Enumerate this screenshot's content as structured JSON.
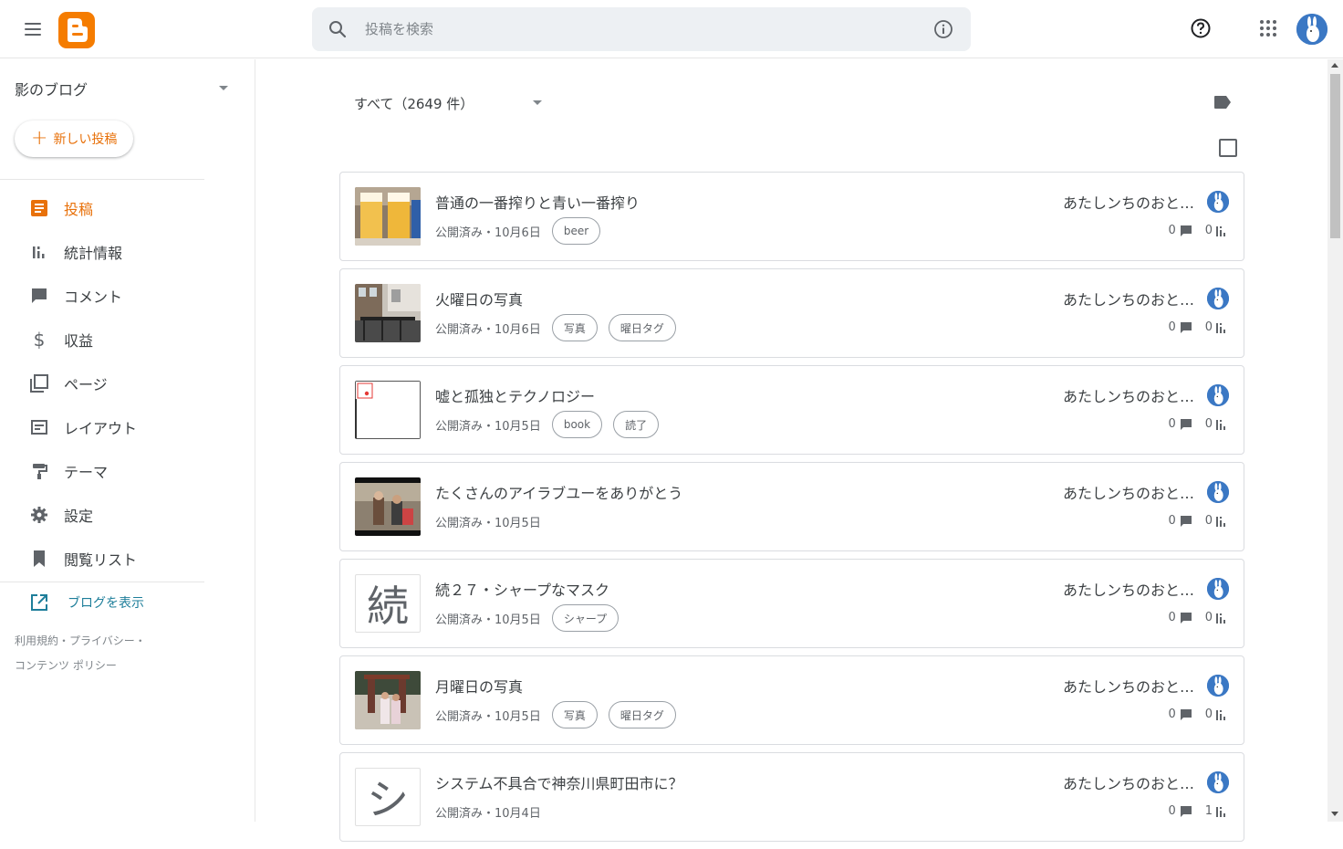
{
  "search": {
    "placeholder": "投稿を検索"
  },
  "sidebar": {
    "blog_name": "影のブログ",
    "new_post_label": "新しい投稿",
    "items": [
      {
        "label": "投稿",
        "icon": "posts-icon",
        "active": true
      },
      {
        "label": "統計情報",
        "icon": "stats-icon",
        "active": false
      },
      {
        "label": "コメント",
        "icon": "comment-icon",
        "active": false
      },
      {
        "label": "収益",
        "icon": "dollar-icon",
        "active": false
      },
      {
        "label": "ページ",
        "icon": "pages-icon",
        "active": false
      },
      {
        "label": "レイアウト",
        "icon": "layout-icon",
        "active": false
      },
      {
        "label": "テーマ",
        "icon": "theme-icon",
        "active": false
      },
      {
        "label": "設定",
        "icon": "gear-icon",
        "active": false
      },
      {
        "label": "閲覧リスト",
        "icon": "bookmark-icon",
        "active": false
      }
    ],
    "view_blog_label": "ブログを表示",
    "footer": {
      "terms": "利用規約",
      "privacy": "プライバシー",
      "content_policy": "コンテンツ ポリシー",
      "dot": "・"
    }
  },
  "main": {
    "filter_label": "すべて（2649 件）",
    "posts": [
      {
        "title": "普通の一番搾りと青い一番搾り",
        "status": "公開済み・10月6日",
        "labels": [
          "beer"
        ],
        "author": "あたしンちのおと…",
        "comments": "0",
        "views": "0",
        "thumb": "beer"
      },
      {
        "title": "火曜日の写真",
        "status": "公開済み・10月6日",
        "labels": [
          "写真",
          "曜日タグ"
        ],
        "author": "あたしンちのおと…",
        "comments": "0",
        "views": "0",
        "thumb": "street"
      },
      {
        "title": "嘘と孤独とテクノロジー",
        "status": "公開済み・10月5日",
        "labels": [
          "book",
          "読了"
        ],
        "author": "あたしンちのおと…",
        "comments": "0",
        "views": "0",
        "thumb": "book"
      },
      {
        "title": "たくさんのアイラブユーをありがとう",
        "status": "公開済み・10月5日",
        "labels": [],
        "author": "あたしンちのおと…",
        "comments": "0",
        "views": "0",
        "thumb": "video"
      },
      {
        "title": "続２７・シャープなマスク",
        "status": "公開済み・10月5日",
        "labels": [
          "シャープ"
        ],
        "author": "あたしンちのおと…",
        "comments": "0",
        "views": "0",
        "thumb_letter": "続"
      },
      {
        "title": "月曜日の写真",
        "status": "公開済み・10月5日",
        "labels": [
          "写真",
          "曜日タグ"
        ],
        "author": "あたしンちのおと…",
        "comments": "0",
        "views": "0",
        "thumb": "people"
      },
      {
        "title": "システム不具合で神奈川県町田市に？",
        "status": "公開済み・10月4日",
        "labels": [],
        "author": "あたしンちのおと…",
        "comments": "0",
        "views": "1",
        "thumb_letter": "シ"
      }
    ]
  },
  "colors": {
    "accent": "#e8710a",
    "logo": "#f57c00",
    "link": "#1e7e9a"
  }
}
